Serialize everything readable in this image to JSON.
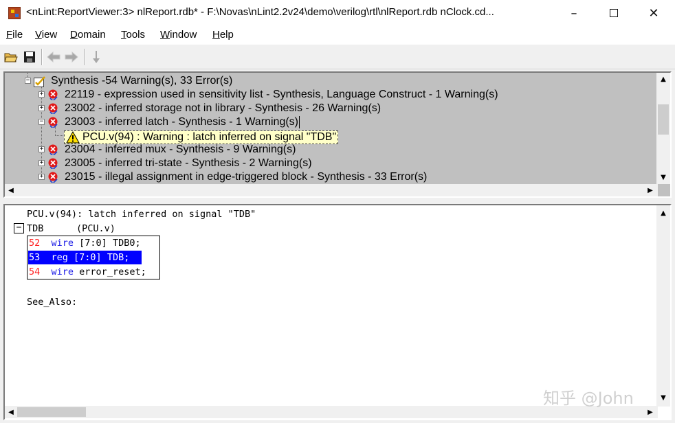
{
  "window": {
    "title": "<nLint:ReportViewer:3> nlReport.rdb* - F:\\Novas\\nLint2.2v24\\demo\\verilog\\rtl\\nlReport.rdb  nClock.cd...",
    "minimize": "–",
    "maximize": "☐",
    "close": "✕"
  },
  "menu": [
    "File",
    "View",
    "Domain",
    "Tools",
    "Window",
    "Help"
  ],
  "toolbar": {
    "buttons": [
      "open-icon",
      "save-icon",
      "back-icon",
      "forward-icon",
      "down-arrow-icon"
    ]
  },
  "tree": {
    "root": "Synthesis -54 Warning(s), 33 Error(s)",
    "rules": [
      "22119 - expression used in sensitivity list - Synthesis, Language Construct - 1 Warning(s)",
      "23002 - inferred storage not in library - Synthesis - 26 Warning(s)",
      "23003 - inferred latch - Synthesis - 1 Warning(s)",
      "23004 - inferred mux - Synthesis - 9 Warning(s)",
      "23005 - inferred tri-state - Synthesis - 2 Warning(s)",
      "23015 - illegal assignment in edge-triggered block - Synthesis - 33 Error(s)"
    ],
    "warning_item": "PCU.v(94) : Warning : latch inferred on signal \"TDB\""
  },
  "detail": {
    "message": "PCU.v(94): latch inferred on signal \"TDB\"",
    "signal_name": "TDB",
    "signal_file": "(PCU.v)",
    "code_lines": [
      {
        "num": "52",
        "kw": "wire",
        "rest": " [7:0] TDB0;"
      },
      {
        "num": "53",
        "kw": "reg",
        "rest": " [7:0] TDB;"
      },
      {
        "num": "54",
        "kw": "wire",
        "rest": " error_reset;"
      }
    ],
    "see_also": "See_Also:"
  },
  "watermark": "知乎 @John",
  "colors": {
    "tree_bg": "#c0c0c0",
    "selection": "#0000ff",
    "line_number": "#ff2020",
    "keyword": "#1a1ae6",
    "warning_bg": "#ffffc8"
  }
}
